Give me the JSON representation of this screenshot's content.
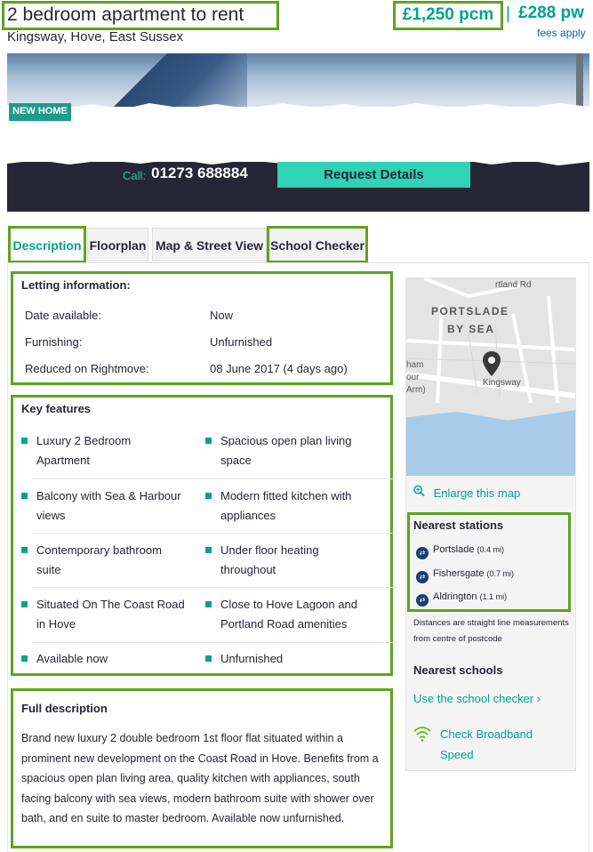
{
  "header": {
    "title": "2 bedroom apartment to rent",
    "address": "Kingsway, Hove, East Sussex",
    "price_pcm": "£1,250 pcm",
    "price_separator": "|",
    "price_pw": "£288 pw",
    "fees": "fees apply"
  },
  "hero": {
    "badge": "NEW HOME",
    "call_label": "Call:",
    "phone": "01273 688884",
    "request_button": "Request Details"
  },
  "tabs": [
    {
      "label": "Description",
      "active": true
    },
    {
      "label": "Floorplan"
    },
    {
      "label": "Map & Street View"
    },
    {
      "label": "School Checker"
    }
  ],
  "letting": {
    "title": "Letting information:",
    "rows": [
      {
        "key": "Date available:",
        "value": "Now"
      },
      {
        "key": "Furnishing:",
        "value": "Unfurnished"
      },
      {
        "key": "Reduced on Rightmove:",
        "value": "08 June 2017 (4 days ago)"
      }
    ]
  },
  "features": {
    "title": "Key features",
    "items": [
      "Luxury 2 Bedroom Apartment",
      "Spacious open plan living space",
      "Balcony with Sea & Harbour views",
      "Modern fitted kitchen with appliances",
      "Contemporary bathroom suite",
      "Under floor heating throughout",
      "Situated On The Coast Road in Hove",
      "Close to Hove Lagoon and Portland Road amenities",
      "Available now",
      "Unfurnished"
    ]
  },
  "full_description": {
    "title": "Full description",
    "text": "Brand new luxury 2 double bedroom 1st floor flat situated within a prominent new development on the Coast Road in Hove. Benefits from a spacious open plan living area, quality kitchen with appliances, south facing balcony with sea views, modern bathroom suite with shower over bath, and en suite to master bedroom. Available now unfurnished."
  },
  "map": {
    "labels": [
      "PORTSLADE",
      "BY SEA",
      "Kingsway",
      "rtland Rd",
      "ham",
      "our",
      "Arm)"
    ],
    "enlarge": "Enlarge this map"
  },
  "stations": {
    "title": "Nearest stations",
    "items": [
      {
        "name": "Portslade",
        "distance": "(0.4 mi)"
      },
      {
        "name": "Fishersgate",
        "distance": "(0.7 mi)"
      },
      {
        "name": "Aldrington",
        "distance": "(1.1 mi)"
      }
    ],
    "note": "Distances are straight line measurements from centre of postcode"
  },
  "schools": {
    "title": "Nearest schools",
    "link": "Use the school checker ›"
  },
  "broadband": {
    "label": "Check Broadband Speed"
  },
  "colors": {
    "accent": "#00a38c",
    "dark": "#262637",
    "cta": "#30d3b3",
    "highlight": "#5fa31f"
  }
}
